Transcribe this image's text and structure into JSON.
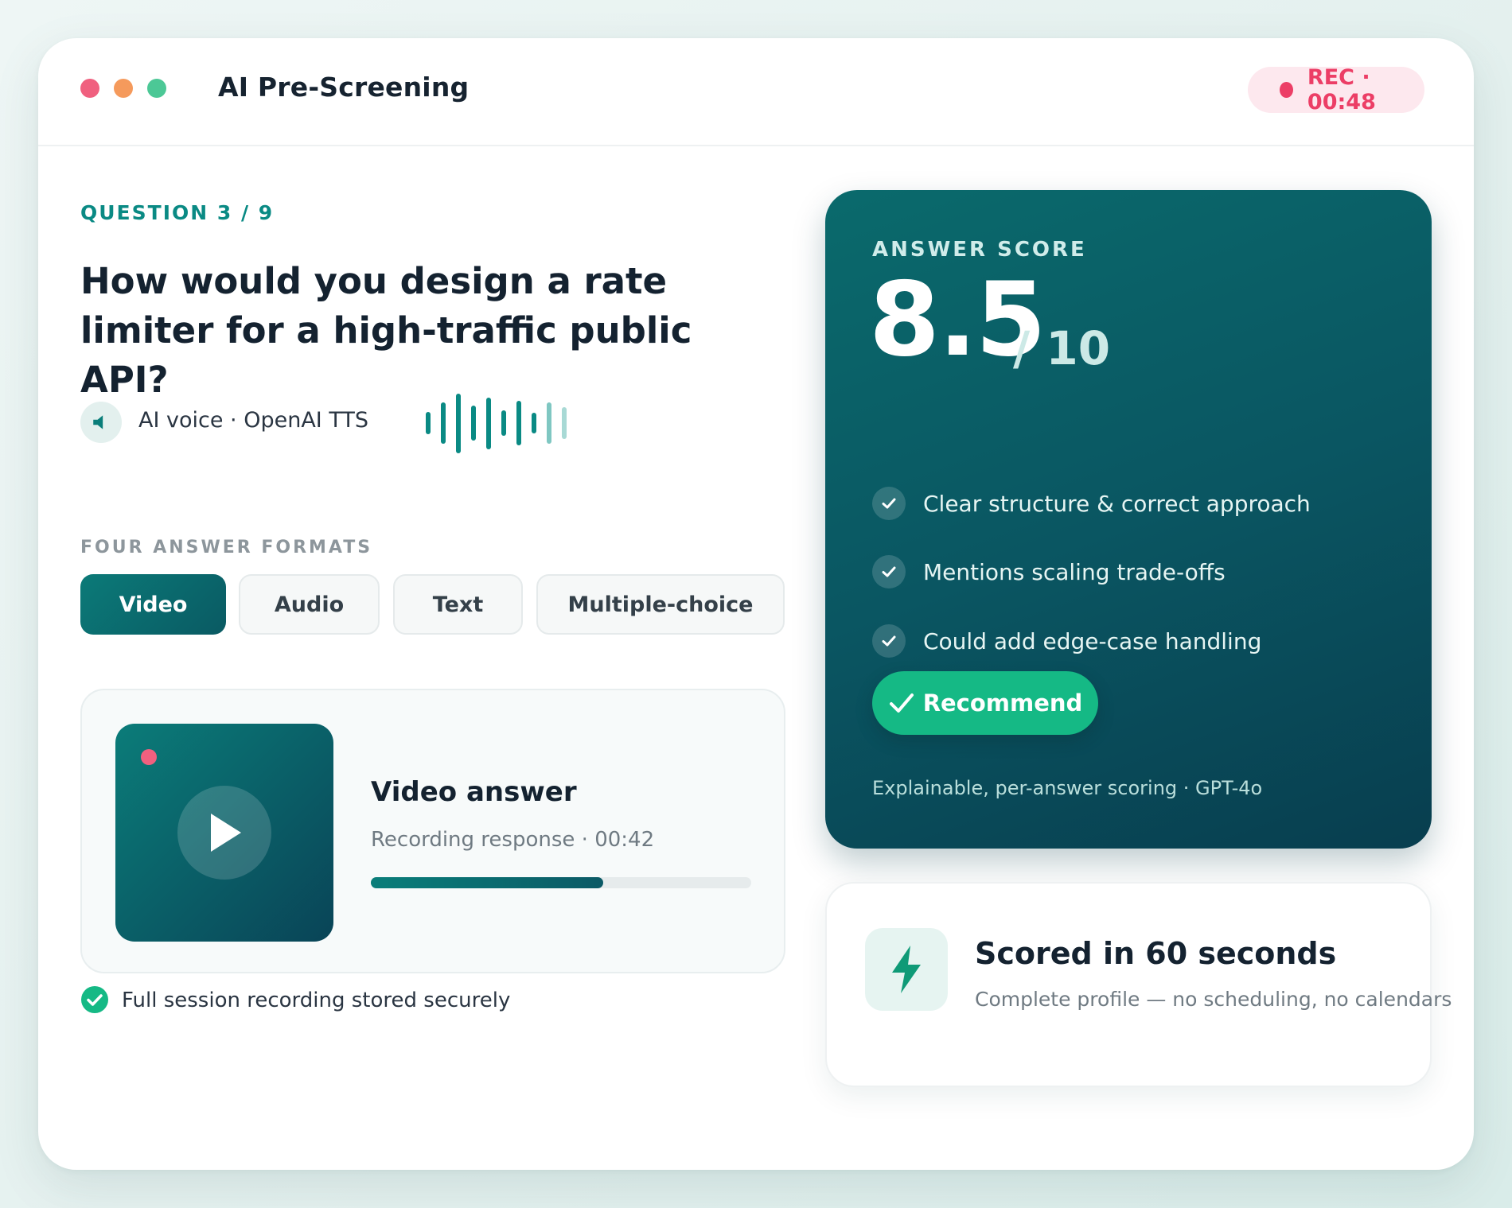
{
  "window": {
    "title": "AI Pre-Screening",
    "rec_label": "REC · 00:48"
  },
  "question": {
    "counter": "QUESTION 3 / 9",
    "text": "How would you design a rate limiter for a high-traffic public API?",
    "voice_label": "AI voice · OpenAI TTS",
    "voice_icon": "speaker-icon",
    "waveform_icon": "audio-waveform-icon"
  },
  "formats": {
    "label": "FOUR ANSWER FORMATS",
    "options": [
      "Video",
      "Audio",
      "Text",
      "Multiple-choice"
    ],
    "selected": "Video"
  },
  "video_answer": {
    "title": "Video answer",
    "subtitle": "Recording response · 00:42",
    "progress": 0.61,
    "play_icon": "play-icon"
  },
  "storage_note": "Full session recording stored securely",
  "score": {
    "label": "ANSWER SCORE",
    "value": "8.5",
    "max": "/ 10",
    "criteria": [
      "Clear structure & correct approach",
      "Mentions scaling trade-offs",
      "Could add edge-case handling"
    ],
    "recommend_label": "Recommend",
    "footnote": "Explainable, per-answer scoring · GPT-4o"
  },
  "speed": {
    "title": "Scored in 60 seconds",
    "subtitle": "Complete profile — no scheduling, no calendars",
    "icon": "lightning-bolt-icon"
  },
  "colors": {
    "accent": "#0a8a84",
    "rec": "#ec3e66",
    "recommend": "#15b985",
    "card_dark": "#0a5662"
  }
}
